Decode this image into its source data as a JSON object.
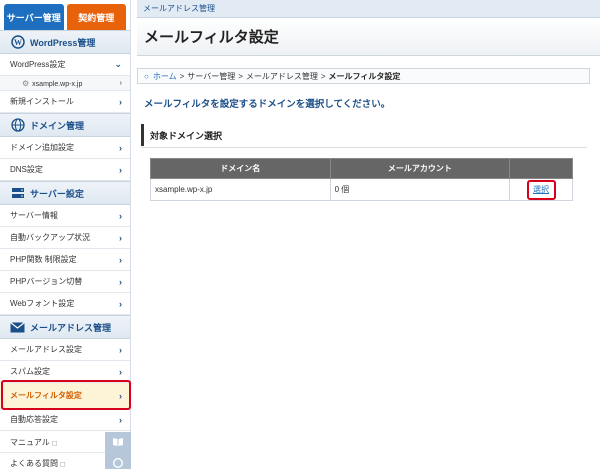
{
  "sidebar": {
    "tabs": [
      {
        "label": "サーバー管理"
      },
      {
        "label": "契約管理"
      }
    ],
    "wordpress": {
      "title": "WordPress管理",
      "items": [
        {
          "label": "WordPress設定"
        }
      ],
      "subitem": "xsample.wp-x.jp",
      "install": "新規インストール"
    },
    "domain": {
      "title": "ドメイン管理",
      "items": [
        {
          "label": "ドメイン追加設定"
        },
        {
          "label": "DNS設定"
        }
      ]
    },
    "server": {
      "title": "サーバー設定",
      "items": [
        {
          "label": "サーバー情報"
        },
        {
          "label": "自動バックアップ状況"
        },
        {
          "label": "PHP関数 制限設定"
        },
        {
          "label": "PHPバージョン切替"
        },
        {
          "label": "Webフォント設定"
        }
      ]
    },
    "mail": {
      "title": "メールアドレス管理",
      "items": [
        {
          "label": "メールアドレス設定"
        },
        {
          "label": "スパム設定"
        },
        {
          "label": "メールフィルタ設定"
        },
        {
          "label": "自動応答設定"
        }
      ]
    },
    "bottom": [
      {
        "label": "マニュアル"
      },
      {
        "label": "よくある質問"
      }
    ],
    "chevron": "›"
  },
  "main": {
    "section_crumb": "メールアドレス管理",
    "title": "メールフィルタ設定",
    "breadcrumb": {
      "home": "ホーム",
      "server": "サーバー管理",
      "mail": "メールアドレス管理",
      "current": "メールフィルタ設定",
      "separator": ">"
    },
    "instruction": "メールフィルタを設定するドメインを選択してください。",
    "section_title": "対象ドメイン選択",
    "table": {
      "headers": [
        "ドメイン名",
        "メールアカウント",
        ""
      ],
      "rows": [
        {
          "domain": "xsample.wp-x.jp",
          "accounts": "0 個",
          "action": "選択"
        }
      ]
    }
  },
  "colors": {
    "accent_blue": "#1e6fbf",
    "contract_orange": "#e8620c",
    "highlight_red": "#d6001c"
  }
}
